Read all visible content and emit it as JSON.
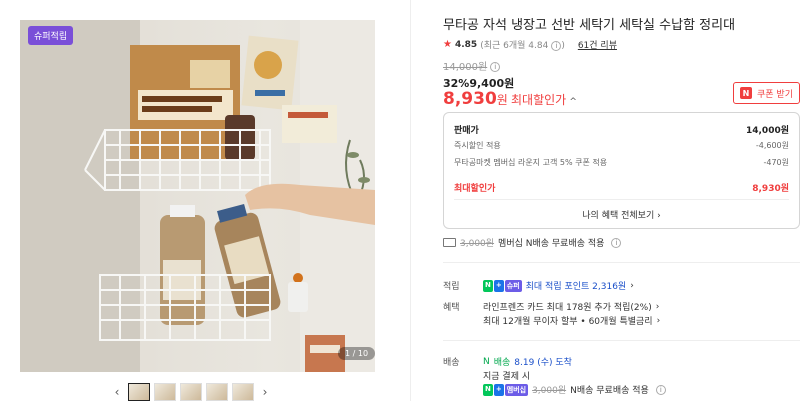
{
  "gallery": {
    "badge": "슈퍼적립",
    "counter": "1 / 10",
    "prev_arrow": "‹",
    "next_arrow": "›"
  },
  "product": {
    "title": "무타공 자석 냉장고 선반 세탁기 세탁실 수납함 정리대",
    "rating": "4.85",
    "rating_sub": "(최근 6개월 4.84",
    "review_link": "61건 리뷰",
    "original_price": "14,000원",
    "discount_percent": "32%",
    "discount_price": "9,400원",
    "final_price": "8,930",
    "final_unit": "원",
    "final_label": "최대할인가",
    "coupon_button": "쿠폰 받기",
    "coupon_icon": "N"
  },
  "price_box": {
    "rows": [
      {
        "label": "판매가",
        "value": "14,000원"
      },
      {
        "label": "즉시할인 적용",
        "value": "-4,600원"
      },
      {
        "label": "무타공마켓 멤버십 라운지 고객 5% 쿠폰 적용",
        "value": "-470원"
      }
    ],
    "total": {
      "label": "최대할인가",
      "value": "8,930원"
    },
    "benefit_link": "나의 혜택 전체보기"
  },
  "shipping_summary": {
    "old_fee": "3,000원",
    "text": "멤버십 N배송 무료배송 적용"
  },
  "points": {
    "label": "적립",
    "text": "최대 적립 포인트 2,316원"
  },
  "benefits": {
    "label": "혜택",
    "line1": "라인프렌즈 카드 최대 178원 추가 적립(2%)",
    "line2": "최대 12개월 무이자 할부 • 60개월 특별금리"
  },
  "delivery": {
    "label": "배송",
    "type": "배송",
    "date": "8.19 (수) 도착",
    "condition": "지금 결제 시",
    "old_fee": "3,000원",
    "fee_text": "N배송 무료배송 적용"
  }
}
